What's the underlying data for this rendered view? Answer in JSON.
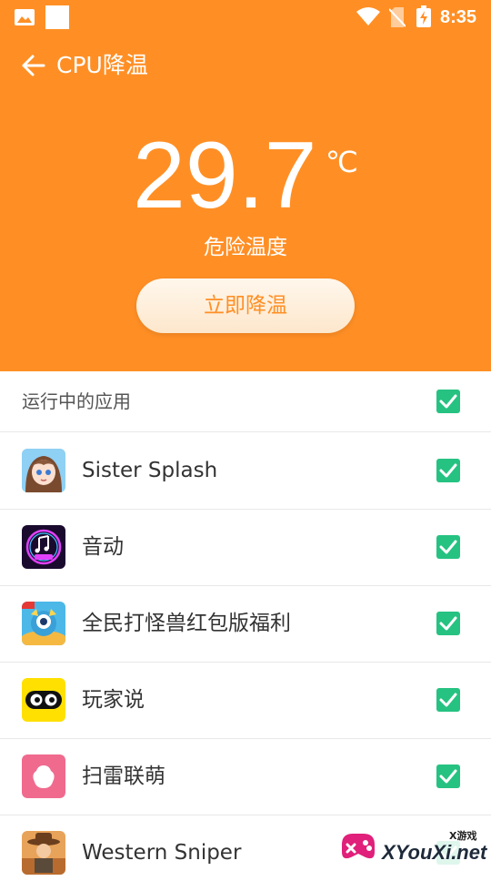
{
  "status_bar": {
    "time": "8:35",
    "icons": [
      "gallery-icon",
      "square-icon",
      "wifi-icon",
      "no-sim-icon",
      "battery-charging-icon"
    ]
  },
  "header": {
    "back_icon": "arrow-left-icon",
    "title": "CPU降温"
  },
  "temperature": {
    "value": "29.7",
    "unit": "℃",
    "status": "危险温度"
  },
  "cool_button": {
    "label": "立即降温"
  },
  "running_apps": {
    "header_label": "运行中的应用",
    "all_checked": true,
    "items": [
      {
        "name": "Sister Splash",
        "icon": "anime-girl-app-icon",
        "checked": true
      },
      {
        "name": "音动",
        "icon": "music-note-app-icon",
        "checked": true
      },
      {
        "name": "全民打怪兽红包版福利",
        "icon": "monster-game-app-icon",
        "checked": true
      },
      {
        "name": "玩家说",
        "icon": "eyes-app-icon",
        "checked": true
      },
      {
        "name": "扫雷联萌",
        "icon": "pink-blob-app-icon",
        "checked": true
      },
      {
        "name": "Western Sniper",
        "icon": "cowboy-app-icon",
        "checked": true
      }
    ]
  },
  "watermark": {
    "small_text": "X游戏",
    "text": "XYouXi.net"
  },
  "colors": {
    "primary_orange": "#FF8F25",
    "check_green": "#26C281",
    "button_bg": "#FFF3E3"
  }
}
